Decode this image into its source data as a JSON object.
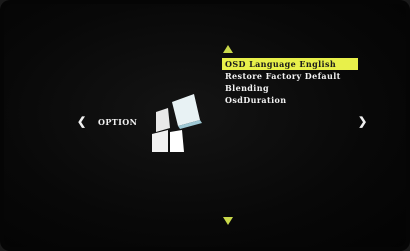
{
  "menu": {
    "items": [
      {
        "label": "OSD Language English",
        "selected": true
      },
      {
        "label": "Restore Factory Default",
        "selected": false
      },
      {
        "label": "Blending",
        "selected": false
      },
      {
        "label": "OsdDuration",
        "selected": false
      }
    ]
  },
  "category": {
    "label": "OPTION",
    "prev_glyph": "❮",
    "next_glyph": "❯"
  },
  "colors": {
    "highlight": "#e8f04a",
    "arrow": "#c9d94a"
  }
}
